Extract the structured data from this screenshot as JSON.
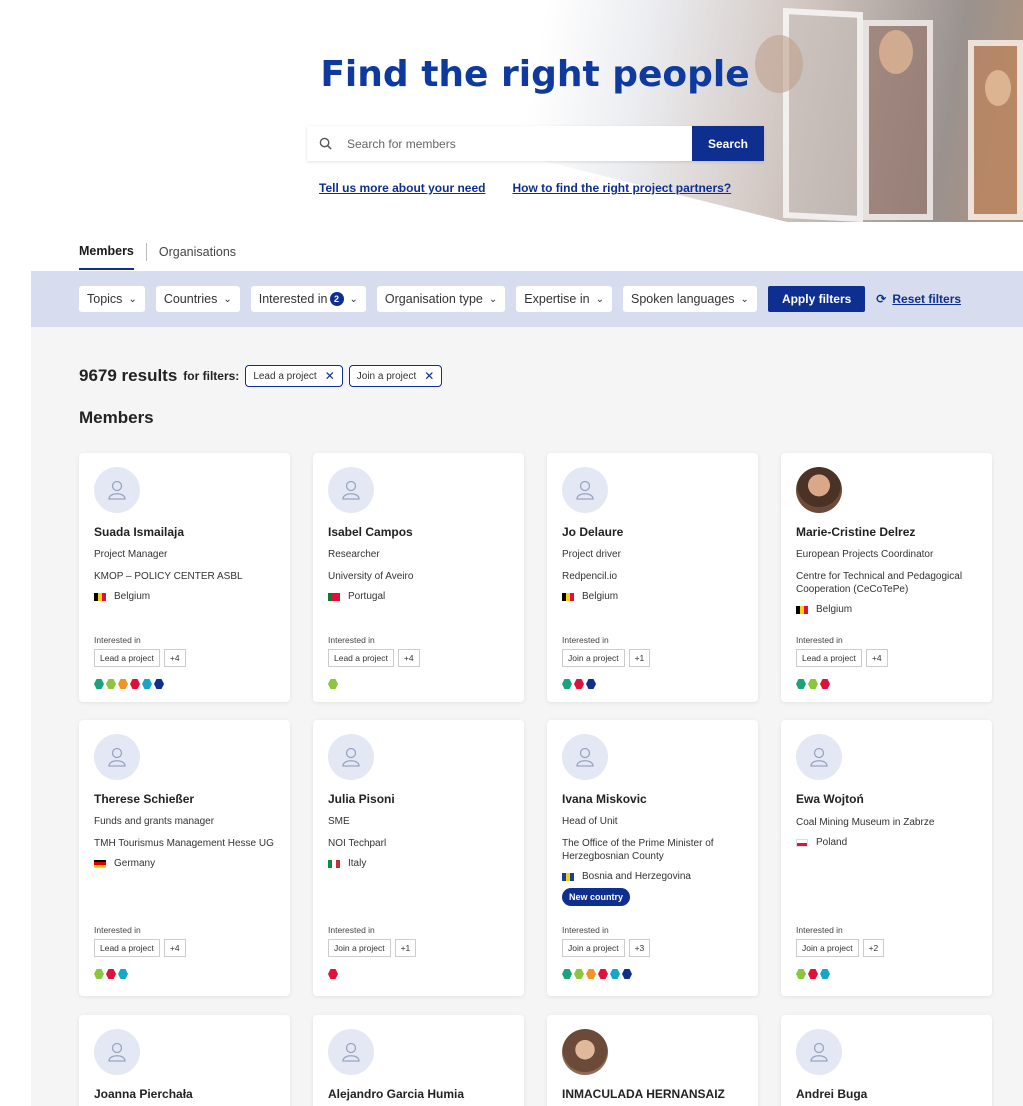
{
  "hero": {
    "title": "Find the right people",
    "search_placeholder": "Search for members",
    "search_button": "Search",
    "link_need": "Tell us more about your need",
    "link_partners": "How to find the right project partners?"
  },
  "tabs": [
    {
      "label": "Members",
      "active": true
    },
    {
      "label": "Organisations",
      "active": false
    }
  ],
  "filters": {
    "topics": "Topics",
    "countries": "Countries",
    "interested_in": "Interested in",
    "interested_count": "2",
    "organisation_type": "Organisation type",
    "expertise_in": "Expertise in",
    "spoken_languages": "Spoken languages",
    "apply": "Apply filters",
    "reset": "Reset filters"
  },
  "results": {
    "count": "9679 results",
    "for_filters": "for filters:",
    "chips": [
      "Lead a project",
      "Join a project"
    ],
    "section_title": "Members"
  },
  "interest_label": "Interested in",
  "colors": {
    "primary": "#0e2f8f",
    "green": "#1aa37a",
    "lime": "#8cc63f",
    "orange": "#f29423",
    "red": "#e0103a",
    "teal": "#17a6c9",
    "navy": "#0e2f8f"
  },
  "members": [
    {
      "name": "Suada Ismailaja",
      "role": "Project Manager",
      "org": "KMOP – POLICY CENTER ASBL",
      "country": "Belgium",
      "flag": "be",
      "tag": "Lead a project",
      "more": "+4",
      "dots": [
        "green",
        "lime",
        "orange",
        "red",
        "teal",
        "navy"
      ],
      "new_country": ""
    },
    {
      "name": "Isabel Campos",
      "role": "Researcher",
      "org": "University of Aveiro",
      "country": "Portugal",
      "flag": "pt",
      "tag": "Lead a project",
      "more": "+4",
      "dots": [
        "lime"
      ],
      "new_country": ""
    },
    {
      "name": "Jo Delaure",
      "role": "Project driver",
      "org": "Redpencil.io",
      "country": "Belgium",
      "flag": "be",
      "tag": "Join a project",
      "more": "+1",
      "dots": [
        "green",
        "red",
        "navy"
      ],
      "new_country": ""
    },
    {
      "name": "Marie-Cristine Delrez",
      "role": "European Projects Coordinator",
      "org": "Centre for Technical and Pedagogical Cooperation (CeCoTePe)",
      "country": "Belgium",
      "flag": "be",
      "tag": "Lead a project",
      "more": "+4",
      "dots": [
        "green",
        "lime",
        "red"
      ],
      "new_country": ""
    },
    {
      "name": "Therese Schießer",
      "role": "Funds and grants manager",
      "org": "TMH Tourismus Management Hesse UG",
      "country": "Germany",
      "flag": "de",
      "tag": "Lead a project",
      "more": "+4",
      "dots": [
        "lime",
        "red",
        "teal"
      ],
      "new_country": ""
    },
    {
      "name": "Julia Pisoni",
      "role": "SME",
      "org": "NOI Techparl",
      "country": "Italy",
      "flag": "it",
      "tag": "Join a project",
      "more": "+1",
      "dots": [
        "red"
      ],
      "new_country": ""
    },
    {
      "name": "Ivana Miskovic",
      "role": "Head of Unit",
      "org": "The Office of the Prime Minister of Herzegbosnian County",
      "country": "Bosnia and Herzegovina",
      "flag": "ba",
      "tag": "Join a project",
      "more": "+3",
      "dots": [
        "green",
        "lime",
        "orange",
        "red",
        "teal",
        "navy"
      ],
      "new_country": "New country"
    },
    {
      "name": "Ewa Wojtoń",
      "role": "",
      "org": "Coal Mining Museum in Zabrze",
      "country": "Poland",
      "flag": "pl",
      "tag": "Join a project",
      "more": "+2",
      "dots": [
        "lime",
        "red",
        "teal"
      ],
      "new_country": ""
    },
    {
      "name": "Joanna Pierchała"
    },
    {
      "name": "Alejandro Garcia Humia"
    },
    {
      "name": "INMACULADA HERNANSAIZ"
    },
    {
      "name": "Andrei Buga"
    }
  ]
}
